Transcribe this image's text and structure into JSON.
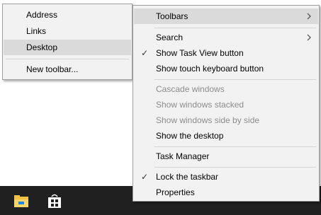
{
  "submenu": {
    "items": [
      {
        "label": "Address"
      },
      {
        "label": "Links"
      },
      {
        "label": "Desktop"
      },
      {
        "label": "New toolbar..."
      }
    ]
  },
  "context_menu": {
    "items": [
      {
        "label": "Toolbars",
        "has_submenu": true
      },
      {
        "label": "Search",
        "has_submenu": true
      },
      {
        "label": "Show Task View button",
        "checked": true
      },
      {
        "label": "Show touch keyboard button"
      },
      {
        "label": "Cascade windows",
        "disabled": true
      },
      {
        "label": "Show windows stacked",
        "disabled": true
      },
      {
        "label": "Show windows side by side",
        "disabled": true
      },
      {
        "label": "Show the desktop"
      },
      {
        "label": "Task Manager"
      },
      {
        "label": "Lock the taskbar",
        "checked": true
      },
      {
        "label": "Properties"
      }
    ]
  },
  "taskbar": {
    "icons": [
      "file-explorer-icon",
      "store-icon"
    ],
    "tray_text": "",
    "background": "#202020"
  },
  "colors": {
    "menu_bg": "#f2f2f2",
    "highlight": "#dadada",
    "disabled_text": "#8c8c8c",
    "explorer_folder": "#f2c143",
    "explorer_accent": "#1e88e5"
  }
}
